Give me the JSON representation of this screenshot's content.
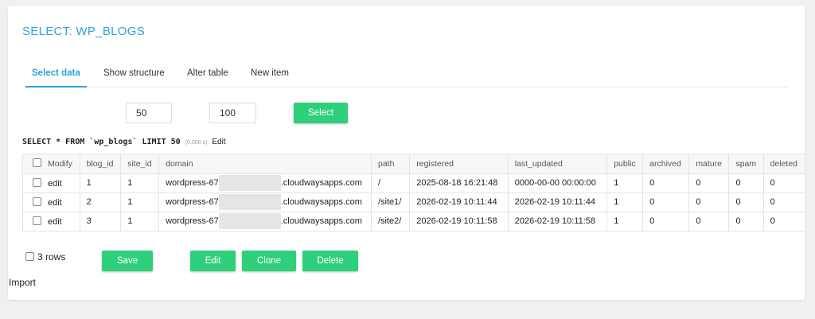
{
  "page": {
    "title": "SELECT: WP_BLOGS"
  },
  "tabs": [
    {
      "label": "Select data",
      "active": true
    },
    {
      "label": "Show structure",
      "active": false
    },
    {
      "label": "Alter table",
      "active": false
    },
    {
      "label": "New item",
      "active": false
    }
  ],
  "controls": {
    "limit_value": "50",
    "text_length_value": "100",
    "select_label": "Select"
  },
  "query": {
    "sql": "SELECT * FROM `wp_blogs` LIMIT 50",
    "time": "(0.000 s)",
    "edit_label": "Edit"
  },
  "table": {
    "columns": [
      "Modify",
      "blog_id",
      "site_id",
      "domain",
      "path",
      "registered",
      "last_updated",
      "public",
      "archived",
      "mature",
      "spam",
      "deleted"
    ],
    "rows": [
      {
        "edit": "edit",
        "blog_id": "1",
        "site_id": "1",
        "domain_prefix": "wordpress-67",
        "domain_suffix": ".cloudwaysapps.com",
        "path": "/",
        "registered": "2025-08-18 16:21:48",
        "last_updated": "0000-00-00 00:00:00",
        "public": "1",
        "archived": "0",
        "mature": "0",
        "spam": "0",
        "deleted": "0"
      },
      {
        "edit": "edit",
        "blog_id": "2",
        "site_id": "1",
        "domain_prefix": "wordpress-67",
        "domain_suffix": ".cloudwaysapps.com",
        "path": "/site1/",
        "registered": "2026-02-19 10:11:44",
        "last_updated": "2026-02-19 10:11:44",
        "public": "1",
        "archived": "0",
        "mature": "0",
        "spam": "0",
        "deleted": "0"
      },
      {
        "edit": "edit",
        "blog_id": "3",
        "site_id": "1",
        "domain_prefix": "wordpress-67",
        "domain_suffix": ".cloudwaysapps.com",
        "path": "/site2/",
        "registered": "2026-02-19 10:11:58",
        "last_updated": "2026-02-19 10:11:58",
        "public": "1",
        "archived": "0",
        "mature": "0",
        "spam": "0",
        "deleted": "0"
      }
    ]
  },
  "footer": {
    "rows_label": "3 rows",
    "save_label": "Save",
    "edit_label": "Edit",
    "clone_label": "Clone",
    "delete_label": "Delete",
    "import_label": "Import"
  },
  "colors": {
    "accent": "#2ea3d8",
    "button_green": "#2fd07b"
  }
}
